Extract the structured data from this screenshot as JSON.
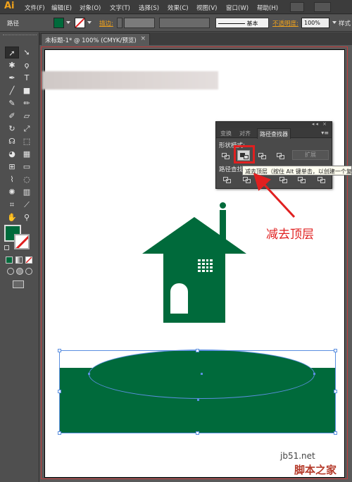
{
  "app": {
    "logo": "Ai"
  },
  "menu": [
    "文件(F)",
    "编辑(E)",
    "对象(O)",
    "文字(T)",
    "选择(S)",
    "效果(C)",
    "视图(V)",
    "窗口(W)",
    "帮助(H)"
  ],
  "control": {
    "selection_label": "路径",
    "stroke_label": "描边:",
    "stroke_style": "基本",
    "opacity_label": "不透明度:",
    "opacity_value": "100%",
    "style_label": "样式"
  },
  "document": {
    "tab_title": "未标题-1* @ 100% (CMYK/预览)",
    "close": "×"
  },
  "panel": {
    "tabs": [
      "变换",
      "对齐",
      "路径查找器"
    ],
    "shape_modes_label": "形状模式:",
    "pathfinders_label": "路径查找器",
    "expand_label": "扩展",
    "tooltip": "减去顶层（按住 Alt 键单击，以创建一个复合形状）"
  },
  "annotation": "减去顶层",
  "watermark": {
    "site": "jb51.net",
    "name": "脚本之家"
  },
  "colors": {
    "fill": "#006a3b",
    "highlight": "#e02020",
    "selection": "#5b8fe0"
  }
}
